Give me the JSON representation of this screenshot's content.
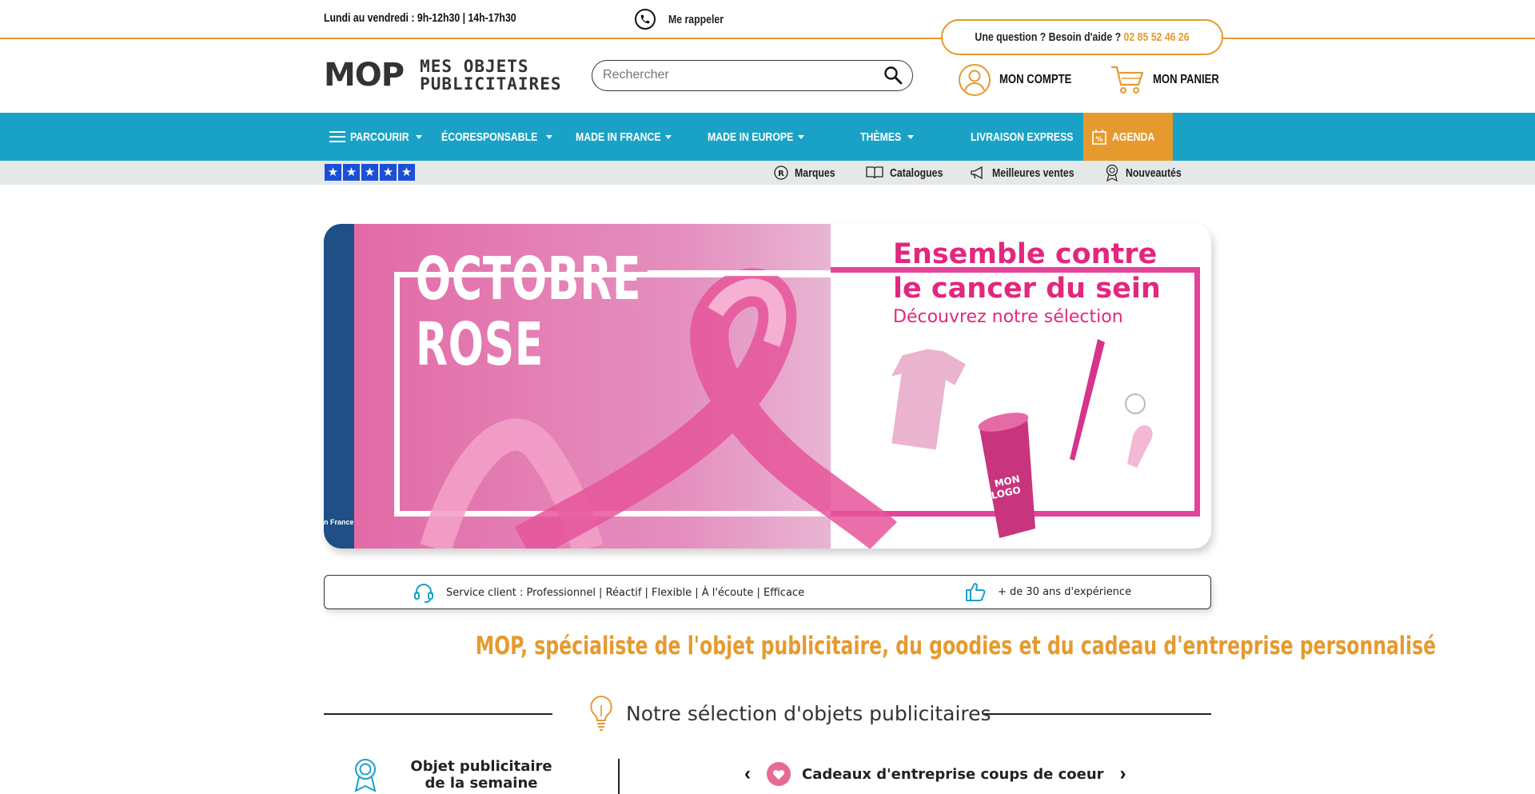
{
  "topbar": {
    "hours": "Lundi au vendredi : 9h-12h30 | 14h-17h30",
    "callback": "Me rappeler",
    "help_text": "Une question ? Besoin d'aide ?",
    "help_phone": "02 85 52 46 26"
  },
  "header": {
    "logo_mark": "MOP",
    "logo_line1": "MES OBJETS",
    "logo_line2": "PUBLICITAIRES",
    "search_placeholder": "Rechercher",
    "account": "MON COMPTE",
    "cart": "MON PANIER"
  },
  "nav": {
    "items": [
      {
        "label": "PARCOURIR"
      },
      {
        "label": "ÉCORESPONSABLE"
      },
      {
        "label": "MADE IN FRANCE"
      },
      {
        "label": "MADE IN EUROPE"
      },
      {
        "label": "THÈMES"
      },
      {
        "label": "LIVRAISON EXPRESS"
      },
      {
        "label": "AGENDA"
      }
    ]
  },
  "subbar": {
    "links": [
      "Marques",
      "Catalogues",
      "Meilleures ventes",
      "Nouveautés"
    ],
    "rating_stars": 5
  },
  "banner": {
    "title_line1": "OCTOBRE",
    "title_line2": "ROSE",
    "headline_line1": "Ensemble contre",
    "headline_line2": "le cancer du sein",
    "subline": "Découvrez notre sélection",
    "corner_text": "n France"
  },
  "service": {
    "client": "Service client : Professionnel | Réactif | Flexible | À l'écoute | Efficace",
    "experience": "+ de 30 ans d'expérience"
  },
  "main": {
    "headline": "MOP, spécialiste de l'objet publicitaire, du goodies et du cadeau d'entreprise personnalisé",
    "selection_title": "Notre sélection d'objets publicitaires",
    "week_title": "Objet publicitaire de la semaine",
    "favorites_title": "Cadeaux d'entreprise coups de coeur"
  },
  "colors": {
    "accent": "#e69a2e",
    "nav": "#1aa2c6",
    "pink": "#e2277e"
  }
}
